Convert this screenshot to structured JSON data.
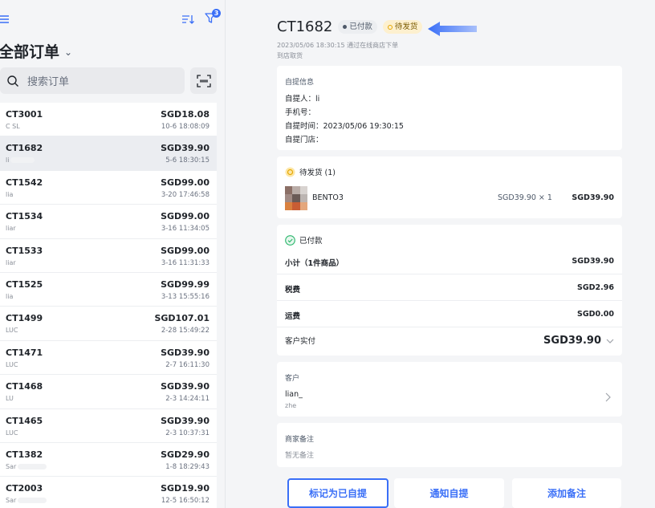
{
  "sidebar": {
    "title": "全部订单",
    "filter_badge": "3",
    "search_placeholder": "搜索订单"
  },
  "orders": [
    {
      "code": "CT3001",
      "amount": "SGD18.08",
      "who": "C SL",
      "when": "10-6 18:08:09"
    },
    {
      "code": "CT1682",
      "amount": "SGD39.90",
      "who": "li",
      "when": "5-6 18:30:15"
    },
    {
      "code": "CT1542",
      "amount": "SGD99.00",
      "who": "lia",
      "when": "3-20 17:46:58"
    },
    {
      "code": "CT1534",
      "amount": "SGD99.00",
      "who": "liar",
      "when": "3-16 11:34:05"
    },
    {
      "code": "CT1533",
      "amount": "SGD99.00",
      "who": "liar",
      "when": "3-16 11:31:33"
    },
    {
      "code": "CT1525",
      "amount": "SGD99.99",
      "who": "lia",
      "when": "3-13 15:55:16"
    },
    {
      "code": "CT1499",
      "amount": "SGD107.01",
      "who": "LUC",
      "when": "2-28 15:49:22"
    },
    {
      "code": "CT1471",
      "amount": "SGD39.90",
      "who": "LUC",
      "when": "2-7 16:11:30"
    },
    {
      "code": "CT1468",
      "amount": "SGD39.90",
      "who": "LU",
      "when": "2-3 14:24:11"
    },
    {
      "code": "CT1465",
      "amount": "SGD39.90",
      "who": "LUC",
      "when": "2-3 10:37:31"
    },
    {
      "code": "CT1382",
      "amount": "SGD29.90",
      "who": "Sar",
      "when": "1-8 18:29:43"
    },
    {
      "code": "CT2003",
      "amount": "SGD19.90",
      "who": "Sar",
      "when": "12-5 16:50:12"
    }
  ],
  "detail": {
    "order_no": "CT1682",
    "paid_tag": "已付款",
    "pending_tag": "待发货",
    "created_line": "2023/05/06 18:30:15 通过在线商店下单",
    "pickup_method": "到店取货",
    "pickup": {
      "header": "自提信息",
      "person": "自提人：li",
      "phone": "手机号：",
      "time": "自提时间：2023/05/06 19:30:15",
      "store": "自提门店："
    },
    "items": {
      "header": "待发货 (1)",
      "name": "BENTO3",
      "unit": "SGD39.90 × 1",
      "total": "SGD39.90"
    },
    "payment": {
      "header": "已付款",
      "subtotal_label": "小计（1件商品）",
      "subtotal": "SGD39.90",
      "tax_label": "税费",
      "tax": "SGD2.96",
      "shipping_label": "运费",
      "shipping": "SGD0.00",
      "paid_label": "客户实付",
      "paid": "SGD39.90"
    },
    "customer": {
      "header": "客户",
      "name": "lian_",
      "sub": "zhe"
    },
    "note": {
      "header": "商家备注",
      "value": "暂无备注"
    },
    "actions": {
      "mark_picked": "标记为已自提",
      "notify": "通知自提",
      "add_note": "添加备注"
    }
  },
  "colors": {
    "accent": "#3a6ff7",
    "pending_bg": "#fdf0cf",
    "paid_green": "#2fb86f"
  }
}
